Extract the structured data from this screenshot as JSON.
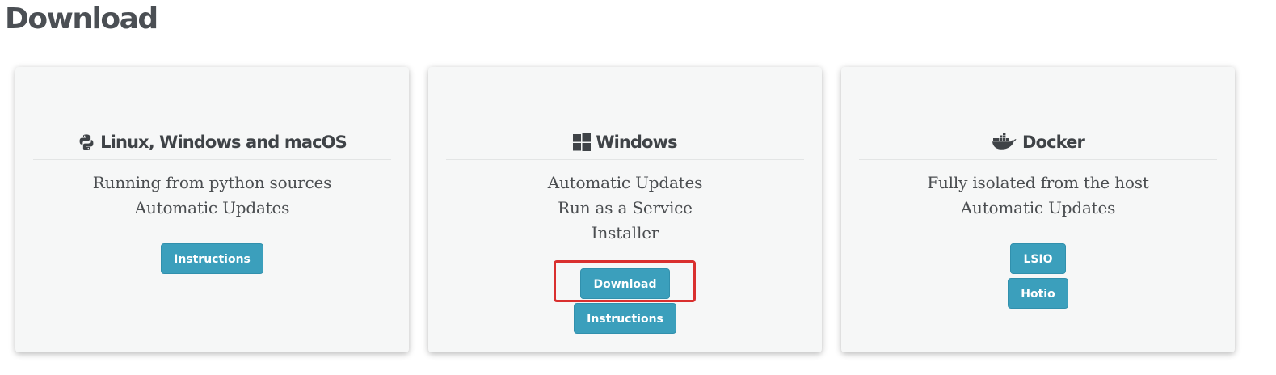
{
  "page": {
    "title": "Download"
  },
  "cards": [
    {
      "icon": "python-icon",
      "title": "Linux, Windows and macOS",
      "features": [
        "Running from python sources",
        "Automatic Updates"
      ],
      "buttons": [
        "Instructions"
      ]
    },
    {
      "icon": "windows-icon",
      "title": "Windows",
      "features": [
        "Automatic Updates",
        "Run as a Service",
        "Installer"
      ],
      "buttons": [
        "Download",
        "Instructions"
      ]
    },
    {
      "icon": "docker-icon",
      "title": "Docker",
      "features": [
        "Fully isolated from the host",
        "Automatic Updates"
      ],
      "buttons": [
        "LSIO",
        "Hotio"
      ]
    }
  ],
  "colors": {
    "button": "#3b9fbc",
    "card_background": "#f6f7f7",
    "highlight": "#d9302f",
    "title_text": "#4b4f54"
  }
}
